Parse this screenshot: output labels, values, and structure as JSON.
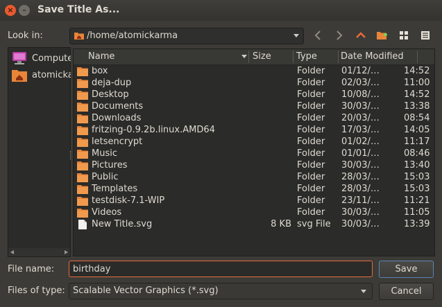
{
  "window": {
    "title": "Save Title As..."
  },
  "lookin": {
    "label": "Look in:",
    "path": "/home/atomickarma"
  },
  "sidebar": {
    "items": [
      {
        "label": "Computer",
        "icon": "computer-icon"
      },
      {
        "label": "atomickarma",
        "icon": "home-folder-icon"
      }
    ]
  },
  "columns": {
    "name": "Name",
    "size": "Size",
    "type": "Type",
    "date": "Date Modified"
  },
  "files": [
    {
      "name": "box",
      "size": "",
      "type": "Folder",
      "date": "01/12/…",
      "time": "14:52",
      "icon": "folder-icon"
    },
    {
      "name": "deja-dup",
      "size": "",
      "type": "Folder",
      "date": "02/03/…",
      "time": "11:00",
      "icon": "folder-icon"
    },
    {
      "name": "Desktop",
      "size": "",
      "type": "Folder",
      "date": "10/08/…",
      "time": "14:52",
      "icon": "folder-icon"
    },
    {
      "name": "Documents",
      "size": "",
      "type": "Folder",
      "date": "30/03/…",
      "time": "13:38",
      "icon": "folder-icon"
    },
    {
      "name": "Downloads",
      "size": "",
      "type": "Folder",
      "date": "20/03/…",
      "time": "08:54",
      "icon": "folder-icon"
    },
    {
      "name": "fritzing-0.9.2b.linux.AMD64",
      "size": "",
      "type": "Folder",
      "date": "17/03/…",
      "time": "14:05",
      "icon": "folder-icon"
    },
    {
      "name": "letsencrypt",
      "size": "",
      "type": "Folder",
      "date": "01/02/…",
      "time": "11:17",
      "icon": "folder-icon"
    },
    {
      "name": "Music",
      "size": "",
      "type": "Folder",
      "date": "01/01/…",
      "time": "08:46",
      "icon": "folder-icon"
    },
    {
      "name": "Pictures",
      "size": "",
      "type": "Folder",
      "date": "30/03/…",
      "time": "13:40",
      "icon": "folder-icon"
    },
    {
      "name": "Public",
      "size": "",
      "type": "Folder",
      "date": "28/03/…",
      "time": "15:03",
      "icon": "folder-icon"
    },
    {
      "name": "Templates",
      "size": "",
      "type": "Folder",
      "date": "28/03/…",
      "time": "15:03",
      "icon": "folder-icon"
    },
    {
      "name": "testdisk-7.1-WIP",
      "size": "",
      "type": "Folder",
      "date": "23/11/…",
      "time": "11:21",
      "icon": "folder-icon"
    },
    {
      "name": "Videos",
      "size": "",
      "type": "Folder",
      "date": "30/03/…",
      "time": "11:05",
      "icon": "folder-icon"
    },
    {
      "name": "New Title.svg",
      "size": "8 KB",
      "type": "svg File",
      "date": "30/03/…",
      "time": "13:39",
      "icon": "file-icon"
    }
  ],
  "filename": {
    "label": "File name:",
    "value": "birthday"
  },
  "filetype": {
    "label": "Files of type:",
    "value": "Scalable Vector Graphics (*.svg)"
  },
  "buttons": {
    "save": "Save",
    "cancel": "Cancel"
  },
  "colors": {
    "accent": "#e96c3c",
    "folder": "#e8853a"
  }
}
